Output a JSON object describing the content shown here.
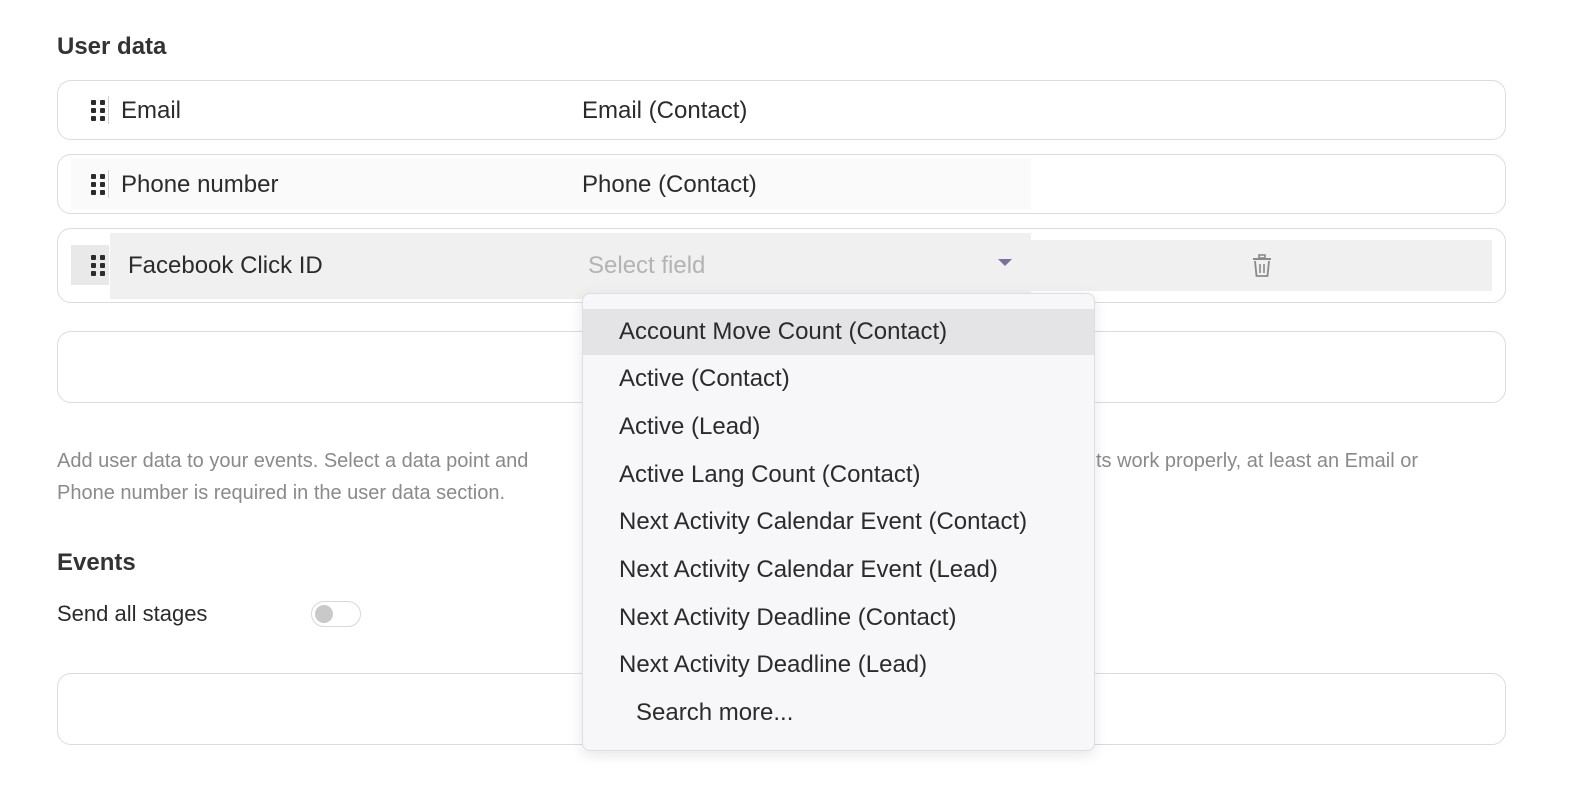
{
  "user_data": {
    "title": "User data",
    "rows": [
      {
        "label": "Email",
        "value": "Email (Contact)"
      },
      {
        "label": "Phone number",
        "value": "Phone (Contact)"
      },
      {
        "label": "Facebook Click ID",
        "placeholder": "Select field"
      }
    ],
    "help_left": "Add user data to your events. Select a data point and",
    "help_right": "ts work properly, at least an Email or",
    "help_line2": "Phone number is required in the user data section."
  },
  "dropdown": {
    "options": [
      "Account Move Count (Contact)",
      "Active (Contact)",
      "Active (Lead)",
      "Active Lang Count (Contact)",
      "Next Activity Calendar Event (Contact)",
      "Next Activity Calendar Event (Lead)",
      "Next Activity Deadline (Contact)",
      "Next Activity Deadline (Lead)"
    ],
    "search_more": "Search more...",
    "highlighted_index": 0
  },
  "events": {
    "title": "Events",
    "send_all_stages_label": "Send all stages",
    "send_all_stages_on": false
  },
  "icons": {
    "drag": "drag-handle-icon",
    "trash": "trash-icon",
    "caret": "caret-down-icon"
  },
  "colors": {
    "caret": "#7b6f9c",
    "placeholder": "#b3b3b3",
    "highlight": "#e4e4e7"
  }
}
